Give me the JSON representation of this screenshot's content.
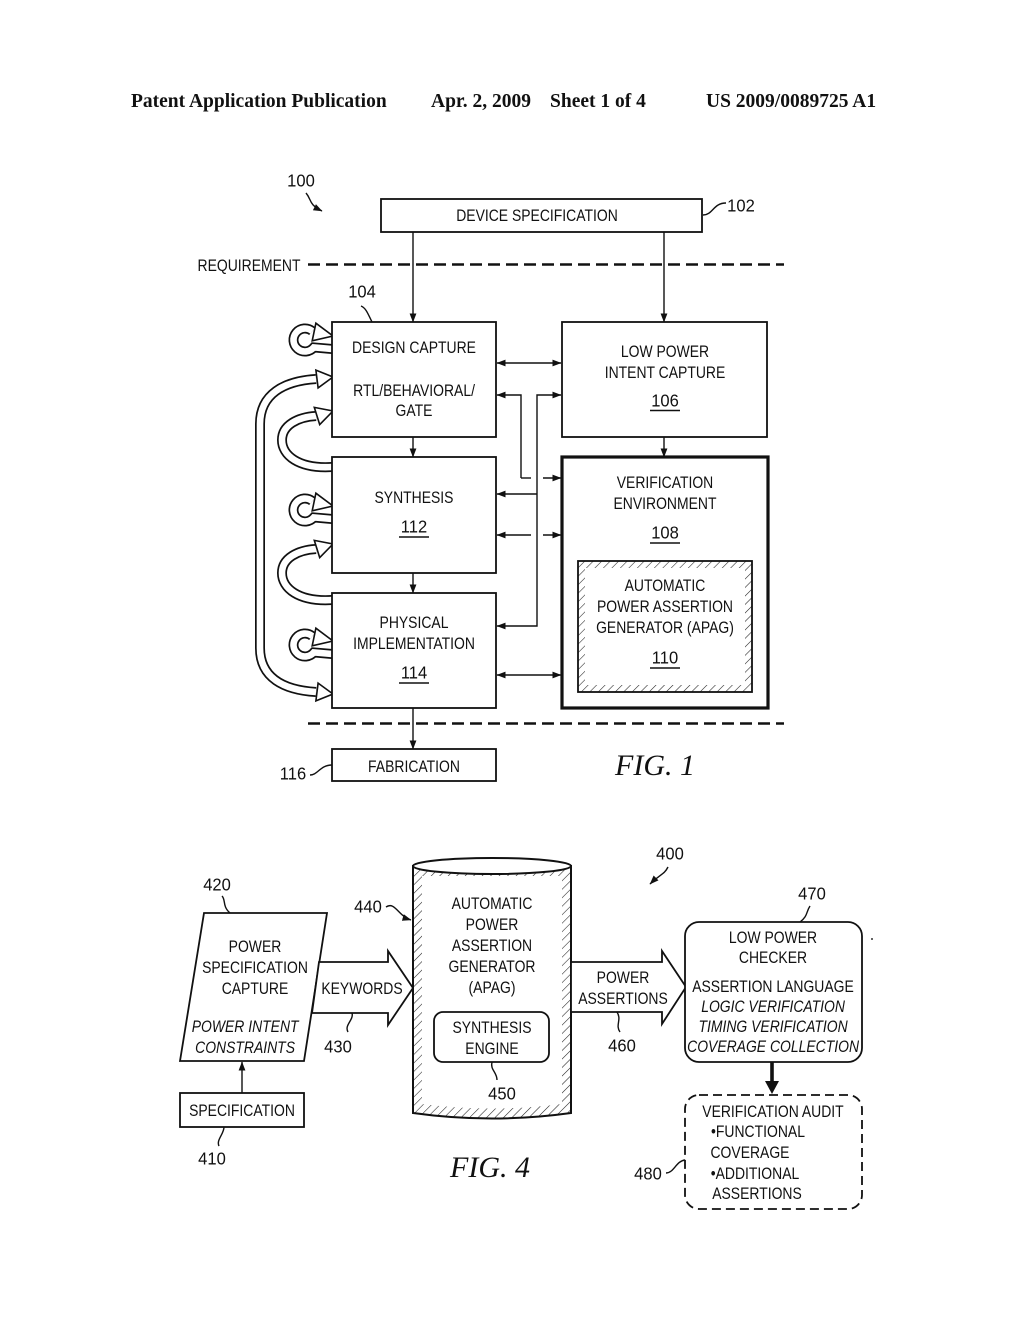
{
  "header": {
    "publication_type": "Patent Application Publication",
    "date": "Apr. 2, 2009",
    "sheet": "Sheet 1 of 4",
    "publication_number": "US 2009/0089725 A1"
  },
  "colors": {
    "ink": "#111111",
    "paper": "#ffffff"
  },
  "fig1": {
    "caption": "FIG. 1",
    "ref": "100",
    "requirement_label": "REQUIREMENT",
    "device_specification": {
      "label": "DEVICE SPECIFICATION",
      "ref": "102"
    },
    "design_capture": {
      "lines": [
        "DESIGN CAPTURE",
        "RTL/BEHAVIORAL/",
        "GATE"
      ],
      "ref": "104"
    },
    "low_power_intent_capture": {
      "lines": [
        "LOW POWER",
        "INTENT CAPTURE"
      ],
      "ref": "106"
    },
    "verification_environment": {
      "lines": [
        "VERIFICATION",
        "ENVIRONMENT"
      ],
      "ref": "108"
    },
    "apag": {
      "lines": [
        "AUTOMATIC",
        "POWER ASSERTION",
        "GENERATOR (APAG)"
      ],
      "ref": "110"
    },
    "synthesis": {
      "lines": [
        "SYNTHESIS"
      ],
      "ref": "112"
    },
    "physical_implementation": {
      "lines": [
        "PHYSICAL",
        "IMPLEMENTATION"
      ],
      "ref": "114"
    },
    "fabrication": {
      "label": "FABRICATION",
      "ref": "116"
    }
  },
  "fig4": {
    "caption": "FIG. 4",
    "ref": "400",
    "specification": {
      "label": "SPECIFICATION",
      "ref": "410"
    },
    "power_specification_capture": {
      "lines": [
        "POWER",
        "SPECIFICATION",
        "CAPTURE"
      ],
      "italic_lines": [
        "POWER INTENT",
        "CONSTRAINTS"
      ],
      "ref": "420"
    },
    "keywords_arrow": {
      "label": "KEYWORDS",
      "ref": "430"
    },
    "apag": {
      "lines": [
        "AUTOMATIC",
        "POWER",
        "ASSERTION",
        "GENERATOR",
        "(APAG)"
      ],
      "ref": "440"
    },
    "synthesis_engine": {
      "lines": [
        "SYNTHESIS",
        "ENGINE"
      ],
      "ref": "450"
    },
    "power_assertions_arrow": {
      "lines": [
        "POWER",
        "ASSERTIONS"
      ],
      "ref": "460"
    },
    "low_power_checker": {
      "lines": [
        "LOW POWER",
        "CHECKER"
      ],
      "subtitle": "ASSERTION LANGUAGE",
      "italic_lines": [
        "LOGIC VERIFICATION",
        "TIMING VERIFICATION",
        "COVERAGE COLLECTION"
      ],
      "ref": "470"
    },
    "verification_audit": {
      "title": "VERIFICATION AUDIT",
      "lines": [
        "•FUNCTIONAL",
        "COVERAGE",
        "•ADDITIONAL",
        "ASSERTIONS"
      ],
      "ref": "480"
    }
  }
}
